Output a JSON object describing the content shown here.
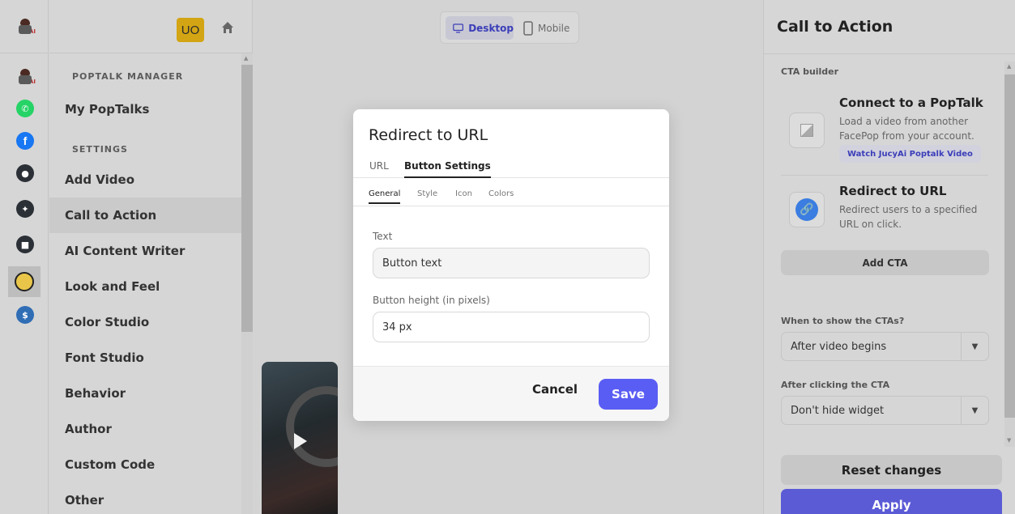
{
  "nav": {
    "avatar_initials": "UO",
    "section_manager": "POPTALK MANAGER",
    "my_poptalks": "My PopTalks",
    "section_settings": "SETTINGS",
    "items": [
      {
        "label": "Add Video"
      },
      {
        "label": "Call to Action",
        "active": true
      },
      {
        "label": "AI Content Writer"
      },
      {
        "label": "Look and Feel"
      },
      {
        "label": "Color Studio"
      },
      {
        "label": "Font Studio"
      },
      {
        "label": "Behavior"
      },
      {
        "label": "Author"
      },
      {
        "label": "Custom Code"
      },
      {
        "label": "Other"
      }
    ]
  },
  "rail": {
    "icons": [
      "mascot-icon",
      "mascot-icon",
      "whatsapp-icon",
      "facebook-icon",
      "user-icon",
      "sparkle-icon",
      "record-icon",
      "cartoon-icon",
      "dollar-icon"
    ],
    "colors": {
      "whatsapp": "#25D366",
      "facebook": "#1877F2",
      "dark": "#2b2f36",
      "dollar": "#2f6db5"
    }
  },
  "preview": {
    "toggle": {
      "desktop": "Desktop",
      "mobile": "Mobile"
    }
  },
  "modal": {
    "title": "Redirect to URL",
    "tabs": [
      "URL",
      "Button Settings"
    ],
    "active_tab": "Button Settings",
    "subtabs": [
      "General",
      "Style",
      "Icon",
      "Colors"
    ],
    "active_subtab": "General",
    "text_label": "Text",
    "text_value": "Button text",
    "height_label": "Button height (in pixels)",
    "height_value": "34 px",
    "cancel": "Cancel",
    "save": "Save",
    "accent": "#5a5df3"
  },
  "panel": {
    "title": "Call to Action",
    "builder_label": "CTA builder",
    "cards": [
      {
        "title": "Connect to a PopTalk",
        "desc": "Load a video from another FacePop from your account.",
        "link": "Watch JucyAi Poptalk Video"
      },
      {
        "title": "Redirect to URL",
        "desc": "Redirect users to a specified URL on click."
      }
    ],
    "add_cta": "Add CTA",
    "when_label": "When to show the CTAs?",
    "when_value": "After video begins",
    "after_label": "After clicking the CTA",
    "after_value": "Don't hide widget",
    "reset": "Reset changes",
    "apply": "Apply"
  }
}
